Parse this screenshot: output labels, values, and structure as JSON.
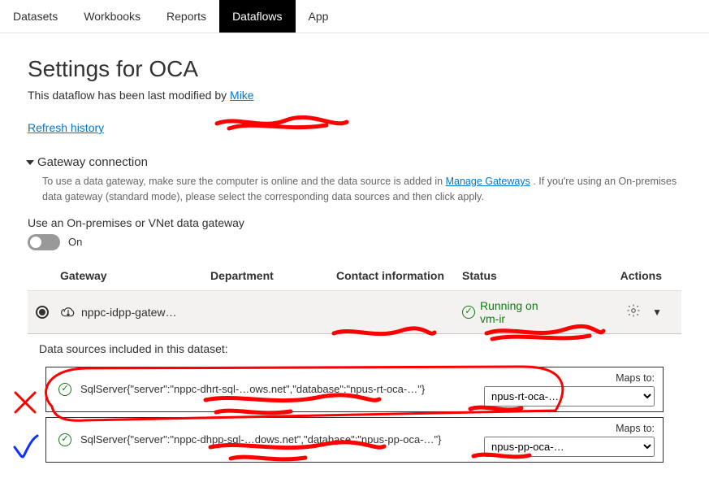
{
  "tabs": {
    "datasets": "Datasets",
    "workbooks": "Workbooks",
    "reports": "Reports",
    "dataflows": "Dataflows",
    "app": "App"
  },
  "page": {
    "title": "Settings for OCA",
    "modified_prefix": "This dataflow has been last modified by ",
    "modified_user": "Mike",
    "refresh_history": "Refresh history"
  },
  "gateway_section": {
    "heading": "Gateway connection",
    "help_before": "To use a data gateway, make sure the computer is online and the data source is added in ",
    "manage_link": "Manage Gateways",
    "help_after": ". If you're using an On-premises data gateway (standard mode), please select the corresponding data sources and then click apply.",
    "toggle_label": "Use an On-premises or VNet data gateway",
    "toggle_state": "On"
  },
  "columns": {
    "gateway": "Gateway",
    "department": "Department",
    "contact": "Contact information",
    "status": "Status",
    "actions": "Actions"
  },
  "gateway_row": {
    "name": "nppc-idpp-gatew…",
    "department": "",
    "contact": "",
    "status_line1": "Running on",
    "status_line2": "vm-ir"
  },
  "datasources": {
    "label": "Data sources included in this dataset:",
    "maps_to": "Maps to:",
    "items": [
      {
        "conn": "SqlServer{\"server\":\"nppc-dhrt-sql-…ows.net\",\"database\":\"npus-rt-oca-…\"}",
        "mapped": "npus-rt-oca-…"
      },
      {
        "conn": "SqlServer{\"server\":\"nppc-dhpp-sql-…dows.net\",\"database\":\"npus-pp-oca-…\"}",
        "mapped": "npus-pp-oca-…"
      }
    ]
  },
  "icons": {
    "gateway": "gateway-icon",
    "gear": "gear-icon",
    "chevron": "chevron-down-icon",
    "check": "check-circle-icon"
  }
}
